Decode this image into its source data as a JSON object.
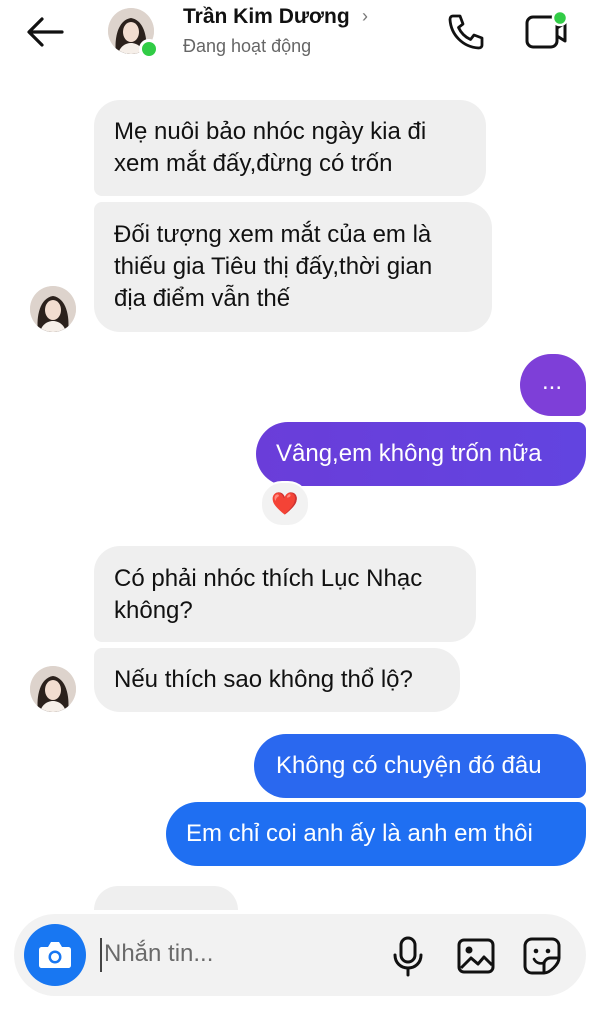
{
  "header": {
    "name": "Trần Kim Dương",
    "status": "Đang hoạt động",
    "chevron": "›"
  },
  "messages": [
    {
      "from": "contact",
      "lines": [
        "Mẹ nuôi bảo nhóc ngày kia đi",
        "xem mắt đấy,đừng có trốn"
      ]
    },
    {
      "from": "contact",
      "lines": [
        "Đối tượng xem mắt của em là",
        "thiếu gia Tiêu thị đấy,thời gian",
        "địa điểm vẫn thế"
      ]
    },
    {
      "from": "me",
      "lines": [
        "..."
      ]
    },
    {
      "from": "me",
      "lines": [
        "Vâng,em không trốn nữa"
      ],
      "reaction": "❤️"
    },
    {
      "from": "contact",
      "lines": [
        "Có phải nhóc thích Lục Nhạc",
        "không?"
      ]
    },
    {
      "from": "contact",
      "lines": [
        "Nếu thích sao không thổ lộ?"
      ]
    },
    {
      "from": "me",
      "lines": [
        "Không có chuyện đó đâu"
      ]
    },
    {
      "from": "me",
      "lines": [
        "Em chỉ coi anh ấy là anh em thôi"
      ]
    }
  ],
  "composer": {
    "placeholder": "Nhắn tin..."
  },
  "icons": [
    "back-arrow-icon",
    "phone-icon",
    "video-call-icon",
    "camera-icon",
    "microphone-icon",
    "gallery-icon",
    "sticker-icon"
  ],
  "colors": {
    "online": "#31cc46",
    "incoming_bubble": "#efefef",
    "outgoing_purple": "#6a3fd9",
    "outgoing_blue": "#1d6ff2",
    "camera_button": "#1877f2"
  }
}
